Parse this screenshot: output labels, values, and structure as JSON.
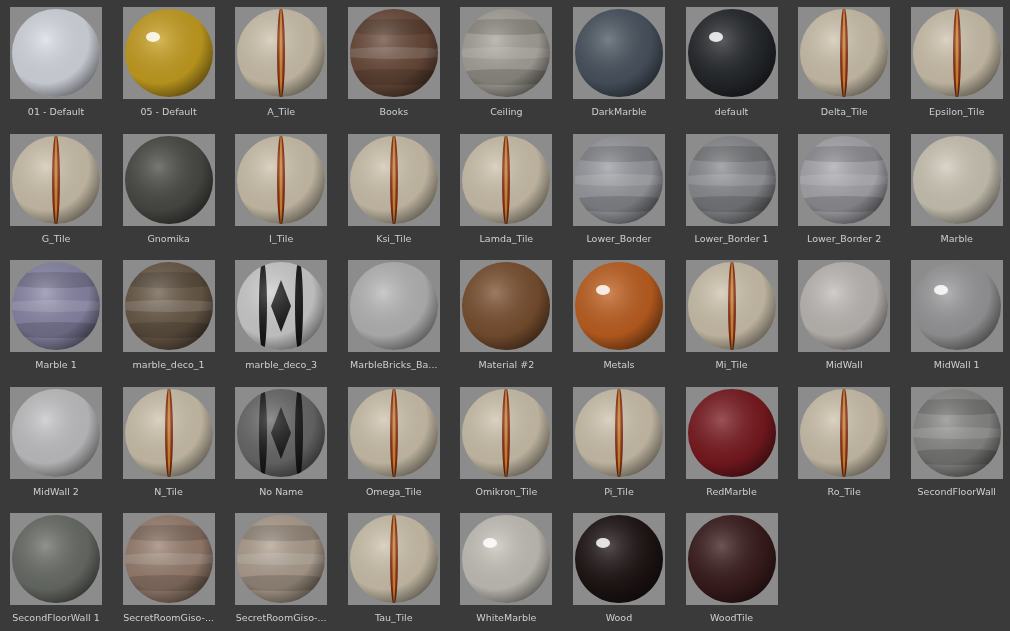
{
  "materials": [
    {
      "name": "01 - Default"
    },
    {
      "name": "05 - Default"
    },
    {
      "name": "A_Tile"
    },
    {
      "name": "Books"
    },
    {
      "name": "Ceiling"
    },
    {
      "name": "DarkMarble"
    },
    {
      "name": "default"
    },
    {
      "name": "Delta_Tile"
    },
    {
      "name": "Epsilon_Tile"
    },
    {
      "name": "G_Tile"
    },
    {
      "name": "Gnomika"
    },
    {
      "name": "I_Tile"
    },
    {
      "name": "Ksi_Tile"
    },
    {
      "name": "Lamda_Tile"
    },
    {
      "name": "Lower_Border"
    },
    {
      "name": "Lower_Border 1"
    },
    {
      "name": "Lower_Border 2"
    },
    {
      "name": "Marble"
    },
    {
      "name": "Marble 1"
    },
    {
      "name": "marble_deco_1"
    },
    {
      "name": "marble_deco_3"
    },
    {
      "name": "MarbleBricks_Ba..."
    },
    {
      "name": "Material #2"
    },
    {
      "name": "Metals"
    },
    {
      "name": "Mi_Tile"
    },
    {
      "name": "MidWall"
    },
    {
      "name": "MidWall 1"
    },
    {
      "name": "MidWall 2"
    },
    {
      "name": "N_Tile"
    },
    {
      "name": "No Name"
    },
    {
      "name": "Omega_Tile"
    },
    {
      "name": "Omikron_Tile"
    },
    {
      "name": "Pi_Tile"
    },
    {
      "name": "RedMarble"
    },
    {
      "name": "Ro_Tile"
    },
    {
      "name": "SecondFloorWall"
    },
    {
      "name": "SecondFloorWall 1"
    },
    {
      "name": "SecretRoomGiso-..."
    },
    {
      "name": "SecretRoomGiso-..."
    },
    {
      "name": "Tau_Tile"
    },
    {
      "name": "WhiteMarble"
    },
    {
      "name": "Wood"
    },
    {
      "name": "WoodTile"
    }
  ]
}
